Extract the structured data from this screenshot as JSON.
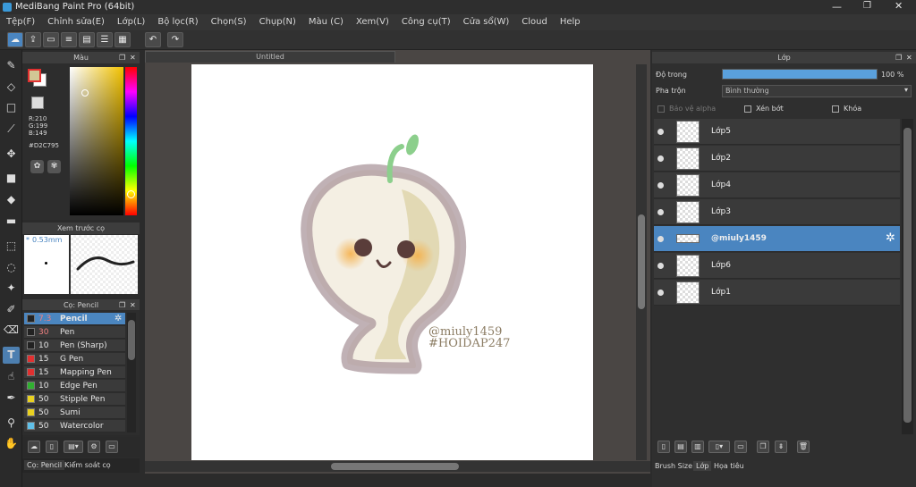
{
  "window": {
    "title": "MediBang Paint Pro (64bit)"
  },
  "menu": [
    "Tệp(F)",
    "Chỉnh sửa(E)",
    "Lớp(L)",
    "Bộ lọc(R)",
    "Chọn(S)",
    "Chụp(N)",
    "Màu (C)",
    "Xem(V)",
    "Công cụ(T)",
    "Cửa sổ(W)",
    "Cloud",
    "Help"
  ],
  "color_panel": {
    "title": "Màu",
    "r": "R:210",
    "g": "G:199",
    "b": "B:149",
    "hex": "#D2C795",
    "fg": "#D2C795",
    "bg": "#ffffff"
  },
  "brush_preview": {
    "title": "Xem trước cọ",
    "size": "0.53mm"
  },
  "brush_panel": {
    "title": "Cọ: Pencil",
    "items": [
      {
        "size": "7.3",
        "name": "Pencil",
        "color": "#222222"
      },
      {
        "size": "30",
        "name": "Pen",
        "color": "#222222"
      },
      {
        "size": "10",
        "name": "Pen (Sharp)",
        "color": "#222222"
      },
      {
        "size": "15",
        "name": "G Pen",
        "color": "#e03030"
      },
      {
        "size": "15",
        "name": "Mapping Pen",
        "color": "#e03030"
      },
      {
        "size": "10",
        "name": "Edge Pen",
        "color": "#30b030"
      },
      {
        "size": "50",
        "name": "Stipple Pen",
        "color": "#e8d020"
      },
      {
        "size": "50",
        "name": "Sumi",
        "color": "#e8d020"
      },
      {
        "size": "50",
        "name": "Watercolor",
        "color": "#60c0e8"
      }
    ]
  },
  "left_tabs": {
    "brush": "Cọ: Pencil",
    "control": "Kiểm soát cọ"
  },
  "canvas": {
    "tab_title": "Untitled",
    "watermark1": "@miuly1459",
    "watermark2": "#HOIDAP247"
  },
  "layer_panel": {
    "title": "Lớp",
    "opacity_label": "Độ trong",
    "opacity_value": "100 %",
    "opacity": 1.0,
    "blend_label": "Pha trộn",
    "blend_value": "Bình thường",
    "alpha_protect": "Bảo vệ alpha",
    "clipping": "Xén bớt",
    "lock": "Khóa",
    "layers": [
      "Lớp5",
      "Lớp2",
      "Lớp4",
      "Lớp3",
      "@miuly1459",
      "Lớp6",
      "Lớp1"
    ]
  },
  "right_tabs": {
    "brush_size": "Brush Size",
    "layer": "Lớp",
    "material": "Họa tiêu"
  },
  "colors": {
    "accent": "#4a85c0",
    "hue_bar": "rainbow"
  }
}
